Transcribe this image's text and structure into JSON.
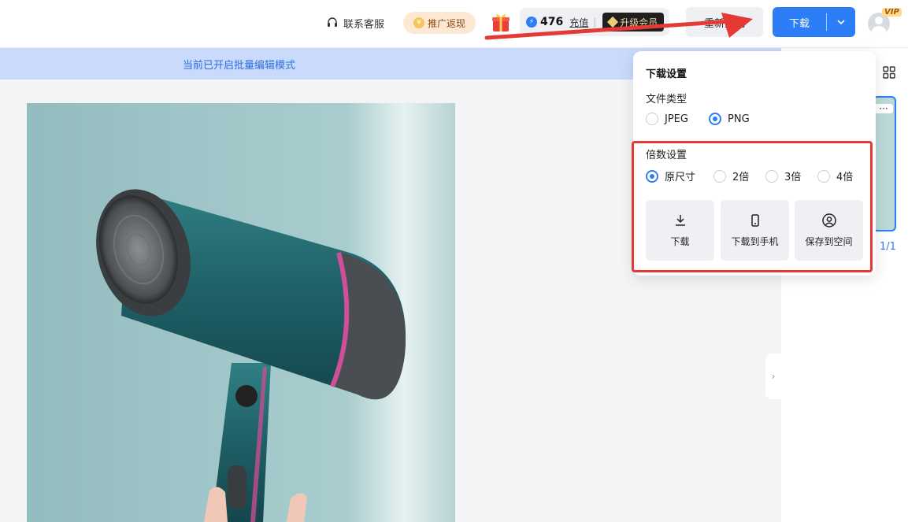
{
  "header": {
    "support_label": "联系客服",
    "promo_label": "推广返现",
    "credits": "476",
    "recharge_label": "充值",
    "upgrade_label": "升级会员",
    "regenerate_label": "重新生成",
    "download_label": "下载",
    "vip_badge": "VIP"
  },
  "banner": {
    "text": "当前已开启批量编辑模式"
  },
  "right_panel": {
    "page_counter": "1/1"
  },
  "download_menu": {
    "title": "下载设置",
    "file_type_label": "文件类型",
    "file_types": [
      {
        "label": "JPEG",
        "selected": false
      },
      {
        "label": "PNG",
        "selected": true
      }
    ],
    "scale_label": "倍数设置",
    "scales": [
      {
        "label": "原尺寸",
        "selected": true
      },
      {
        "label": "2倍",
        "selected": false
      },
      {
        "label": "3倍",
        "selected": false
      },
      {
        "label": "4倍",
        "selected": false
      }
    ],
    "actions": [
      {
        "label": "下载",
        "icon": "download-icon"
      },
      {
        "label": "下载到手机",
        "icon": "phone-icon"
      },
      {
        "label": "保存到空间",
        "icon": "user-circle-icon"
      }
    ]
  },
  "colors": {
    "accent": "#2d7df6",
    "annotation": "#e53935",
    "banner_bg": "#c9dafc"
  }
}
